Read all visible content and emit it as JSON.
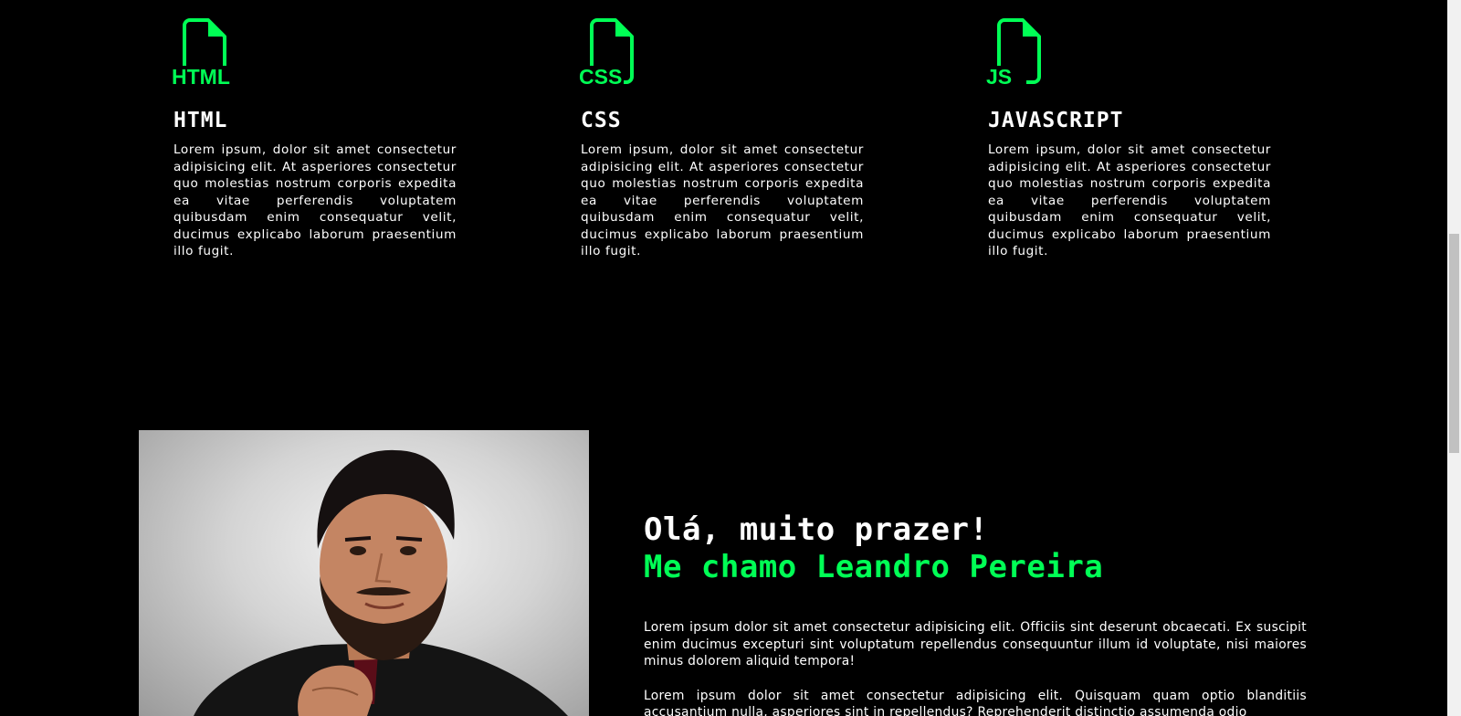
{
  "skills": [
    {
      "icon_name": "html-file-icon",
      "icon_label": "HTML",
      "title": "HTML",
      "text": "Lorem ipsum, dolor sit amet consectetur adipisicing elit. At asperiores consectetur quo molestias nostrum corporis expedita ea vitae perferendis voluptatem quibusdam enim consequatur velit, ducimus explicabo laborum praesentium illo fugit."
    },
    {
      "icon_name": "css-file-icon",
      "icon_label": "CSS",
      "title": "CSS",
      "text": "Lorem ipsum, dolor sit amet consectetur adipisicing elit. At asperiores consectetur quo molestias nostrum corporis expedita ea vitae perferendis voluptatem quibusdam enim consequatur velit, ducimus explicabo laborum praesentium illo fugit."
    },
    {
      "icon_name": "js-file-icon",
      "icon_label": "JS",
      "title": "JAVASCRIPT",
      "text": "Lorem ipsum, dolor sit amet consectetur adipisicing elit. At asperiores consectetur quo molestias nostrum corporis expedita ea vitae perferendis voluptatem quibusdam enim consequatur velit, ducimus explicabo laborum praesentium illo fugit."
    }
  ],
  "about": {
    "greeting": "Olá, muito prazer!",
    "name_line": "Me chamo Leandro Pereira",
    "paragraph1": "Lorem ipsum dolor sit amet consectetur adipisicing elit. Officiis sint deserunt obcaecati. Ex suscipit enim ducimus excepturi sint voluptatum repellendus consequuntur illum id voluptate, nisi maiores minus dolorem aliquid tempora!",
    "paragraph2": "Lorem ipsum dolor sit amet consectetur adipisicing elit. Quisquam quam optio blanditiis accusantium nulla, asperiores sint in repellendus? Reprehenderit distinctio assumenda odio"
  },
  "colors": {
    "background": "#000000",
    "accent": "#00ff55",
    "text": "#ffffff"
  }
}
